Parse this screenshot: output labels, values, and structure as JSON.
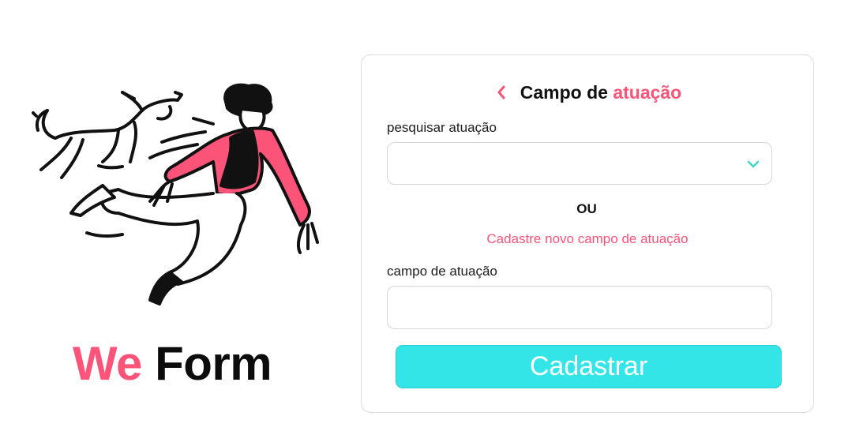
{
  "brand": {
    "part1": "We",
    "part2": "Form"
  },
  "card": {
    "title_main": "Campo de",
    "title_accent": "atuação",
    "search_label": "pesquisar atuação",
    "search_value": "",
    "or_text": "OU",
    "register_link": "Cadastre novo campo de atuação",
    "field_label": "campo de atuação",
    "field_value": "",
    "submit_label": "Cadastrar"
  },
  "colors": {
    "accent": "#fb5478",
    "submit_bg": "#34e5e8",
    "chevron": "#3fd7c0"
  },
  "icons": {
    "back": "chevron-left-icon",
    "dropdown": "chevron-down-icon"
  }
}
